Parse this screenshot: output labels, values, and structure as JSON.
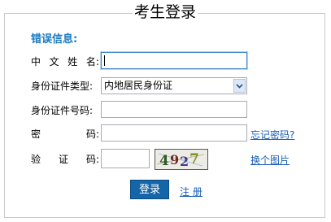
{
  "form": {
    "legend": "考生登录",
    "error_title": "错误信息:",
    "fields": {
      "name_label": "中文姓名:",
      "name_value": "",
      "id_type_label": "身份证件类型:",
      "id_type_selected": "内地居民身份证",
      "id_number_label": "身份证件号码:",
      "id_number_value": "",
      "password_label": "密码:",
      "password_value": "",
      "captcha_label": "验证码:",
      "captcha_value": "",
      "captcha_text": "4927"
    },
    "links": {
      "forgot_password": "忘记密码?",
      "change_image": "换个图片",
      "register": "注 册"
    },
    "buttons": {
      "login": "登录"
    }
  },
  "colors": {
    "accent": "#1a7ac2",
    "link": "#1a5fb4",
    "button_bg": "#1565a9"
  }
}
